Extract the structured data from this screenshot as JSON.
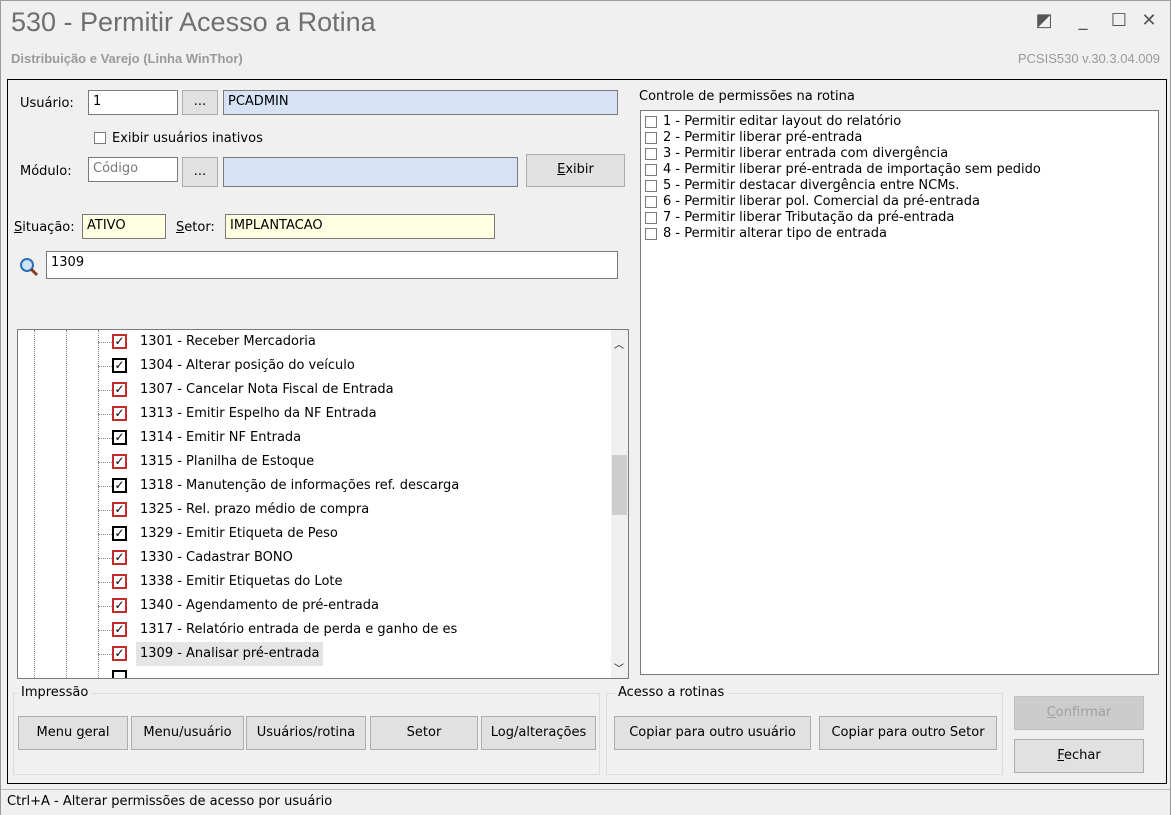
{
  "window": {
    "title": "530 - Permitir Acesso a Rotina",
    "subtitle": "Distribuição e Varejo (Linha WinThor)",
    "version": "PCSIS530  v.30.3.04.009"
  },
  "form": {
    "usuario_label": "Usuário:",
    "usuario_code": "1",
    "usuario_name": "PCADMIN",
    "ellipsis": "...",
    "exibir_inativos_label": "Exibir usuários inativos",
    "modulo_label": "Módulo:",
    "modulo_placeholder": "Código",
    "exibir_button": "Exibir",
    "situacao_label": "Situação:",
    "situacao_value": "ATIVO",
    "setor_label": "Setor:",
    "setor_value": "IMPLANTACAO",
    "search_value": "1309"
  },
  "tree": {
    "items": [
      {
        "label": "1301 - Receber Mercadoria",
        "style": "red"
      },
      {
        "label": "1304 - Alterar posição do veículo",
        "style": "black"
      },
      {
        "label": "1307 - Cancelar Nota Fiscal de  Entrada",
        "style": "red"
      },
      {
        "label": "1313 - Emitir Espelho da NF Entrada",
        "style": "red"
      },
      {
        "label": "1314 - Emitir NF Entrada",
        "style": "black"
      },
      {
        "label": "1315 - Planilha de Estoque",
        "style": "red"
      },
      {
        "label": "1318 - Manutenção de informações ref. descarga",
        "style": "black"
      },
      {
        "label": "1325 - Rel. prazo médio de compra",
        "style": "red"
      },
      {
        "label": "1329 - Emitir Etiqueta de Peso",
        "style": "black"
      },
      {
        "label": "1330 - Cadastrar BONO",
        "style": "red"
      },
      {
        "label": "1338 - Emitir Etiquetas do Lote",
        "style": "red"
      },
      {
        "label": "1340 - Agendamento de pré-entrada",
        "style": "red"
      },
      {
        "label": "1317 - Relatório entrada de perda e ganho de es",
        "style": "red"
      },
      {
        "label": "1309 - Analisar pré-entrada",
        "style": "red",
        "selected": true
      }
    ]
  },
  "permissions": {
    "title": "Controle de permissões na rotina",
    "items": [
      "1 - Permitir editar layout do relatório",
      "2 - Permitir liberar pré-entrada",
      "3 - Permitir liberar entrada com  divergência",
      "4 - Permitir liberar pré-entrada de importação sem pedido",
      "5 - Permitir destacar divergência entre NCMs.",
      "6 - Permitir liberar pol. Comercial da pré-entrada",
      "7 - Permitir liberar Tributação da pré-entrada",
      "8 - Permitir alterar tipo de entrada"
    ]
  },
  "impressao": {
    "title": "Impressão",
    "menu_geral": "Menu geral",
    "menu_usuario": "Menu/usuário",
    "usuarios_rotina": "Usuários/rotina",
    "setor": "Setor",
    "log_alteracoes": "Log/alterações"
  },
  "acesso": {
    "title": "Acesso a rotinas",
    "copiar_usuario": "Copiar para outro usuário",
    "copiar_setor": "Copiar para outro Setor"
  },
  "actions": {
    "confirmar": "Confirmar",
    "fechar": "Fechar"
  },
  "status_text": "Ctrl+A - Alterar permissões de acesso por usuário",
  "colors": {
    "readonly_field": "#d7e3f4",
    "yellow_field": "#ffffe1",
    "tree_check_red": "#c42b2b",
    "selected_row": "#e5e5e5"
  }
}
